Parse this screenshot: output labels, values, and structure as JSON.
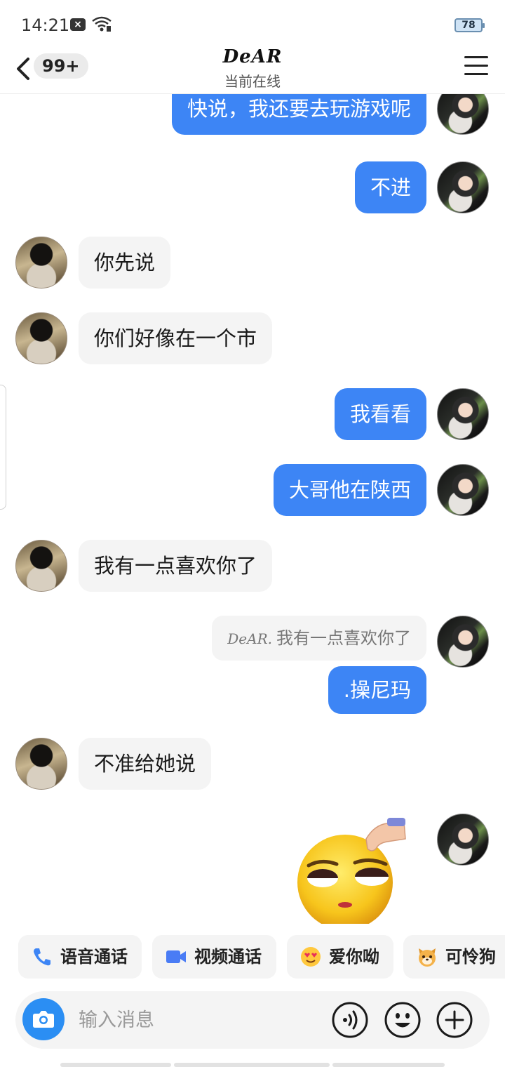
{
  "status_bar": {
    "time": "14:21",
    "battery": "78",
    "icons": [
      "close-notification-icon",
      "wifi-icon"
    ]
  },
  "header": {
    "back_icon": "chevron-left-icon",
    "unread_count": "99+",
    "contact_name": "DeAR",
    "status": "当前在线",
    "menu_icon": "hamburger-menu-icon"
  },
  "messages": [
    {
      "from": "me",
      "text": "快说，我还要去玩游戏呢"
    },
    {
      "from": "me",
      "text": "不进"
    },
    {
      "from": "peer",
      "text": "你先说"
    },
    {
      "from": "peer",
      "text": "你们好像在一个市"
    },
    {
      "from": "me",
      "text": "我看看"
    },
    {
      "from": "me",
      "text": "大哥他在陕西"
    },
    {
      "from": "peer",
      "text": "我有一点喜欢你了"
    },
    {
      "from": "me",
      "quote_name": "DeAR.",
      "quote_text": "我有一点喜欢你了",
      "text": ".操尼玛"
    },
    {
      "from": "peer",
      "text": "不准给她说"
    },
    {
      "from": "me",
      "sticker": "eye-roll-emoji-sticker"
    }
  ],
  "quick_actions": [
    {
      "icon": "phone-icon",
      "label": "语音通话"
    },
    {
      "icon": "video-camera-icon",
      "label": "视频通话"
    },
    {
      "icon": "heart-eyes-emoji-icon",
      "label": "爱你呦"
    },
    {
      "icon": "puppy-emoji-icon",
      "label": "可怜狗"
    }
  ],
  "input_bar": {
    "placeholder": "输入消息",
    "icons": [
      "camera-icon",
      "voice-icon",
      "emoji-icon",
      "plus-icon"
    ]
  },
  "colors": {
    "accent": "#3d85f5",
    "peer_bubble": "#f4f4f4",
    "camera": "#2b8ef3"
  }
}
